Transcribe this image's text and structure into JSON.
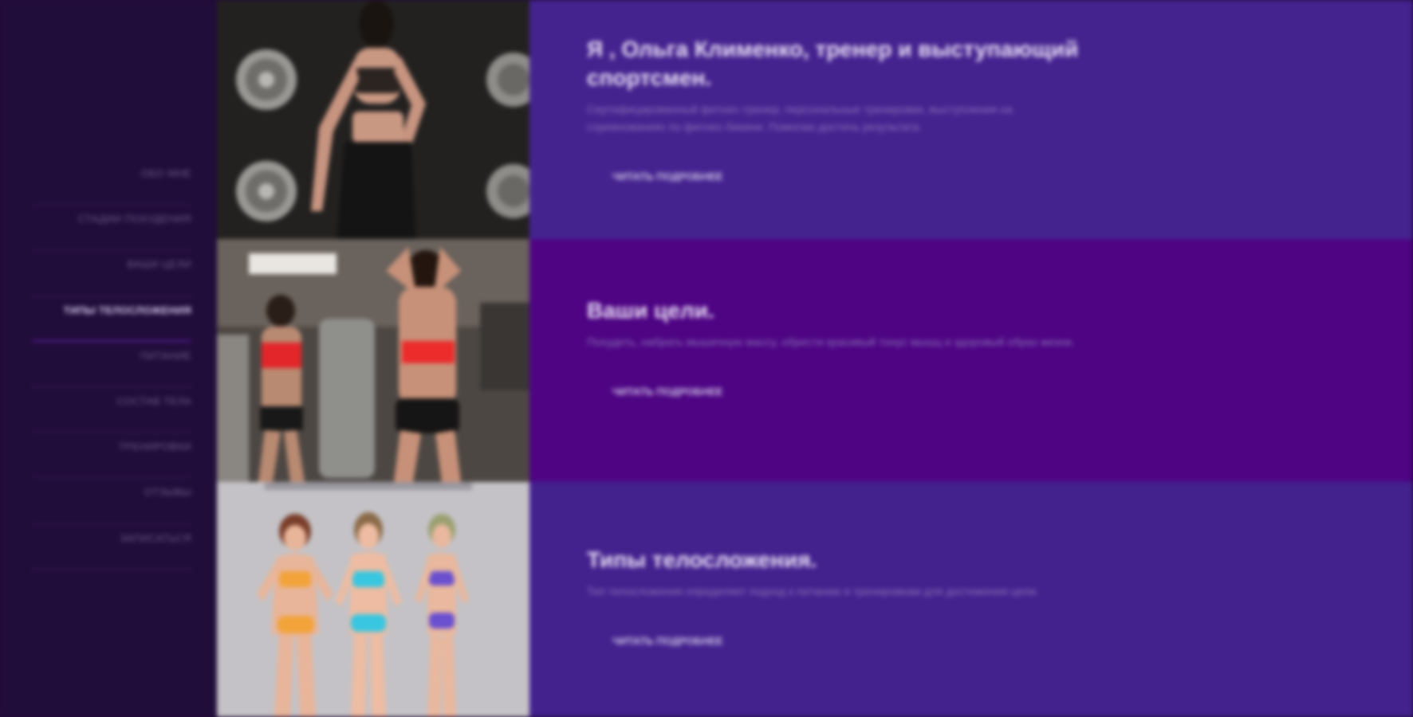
{
  "sidebar": {
    "items": [
      {
        "label": "ОБО МНЕ"
      },
      {
        "label": "СТАДИИ ПОХУДЕНИЯ"
      },
      {
        "label": "ВАШИ ЦЕЛИ"
      },
      {
        "label": "ТИПЫ ТЕЛОСЛОЖЕНИЯ"
      },
      {
        "label": "ПИТАНИЕ"
      },
      {
        "label": "СОСТАВ ТЕЛА"
      },
      {
        "label": "ТРЕНИРОВКИ"
      },
      {
        "label": "ОТЗЫВЫ"
      },
      {
        "label": "ЗАПИСАТЬСЯ"
      }
    ],
    "active_index": 3
  },
  "sections": [
    {
      "title": "Я , Ольга Клименко, тренер и выступающий спортсмен.",
      "description": "Сертифицированный фитнес-тренер, персональные тренировки, выступления на соревнованиях по фитнес-бикини. Помогаю достичь результата.",
      "button": "ЧИТАТЬ ПОДРОБНЕЕ",
      "image_name": "photo-trainer"
    },
    {
      "title": "Ваши цели.",
      "description": "Похудеть, набрать мышечную массу, обрести красивый тонус мышц и здоровый образ жизни.",
      "button": "ЧИТАТЬ ПОДРОБНЕЕ",
      "image_name": "photo-gym"
    },
    {
      "title": "Типы телосложения.",
      "description": "Тип телосложения определяет подход к питанию и тренировкам для достижения цели.",
      "button": "ЧИТАТЬ ПОДРОБНЕЕ",
      "image_name": "photo-body-types"
    }
  ],
  "colors": {
    "sidebar_bg": "#210d3a",
    "row1_bg": "#45238f",
    "row2_bg": "#4e0483",
    "row3_bg": "#44228e",
    "active_underline": "#5a1ea0"
  }
}
